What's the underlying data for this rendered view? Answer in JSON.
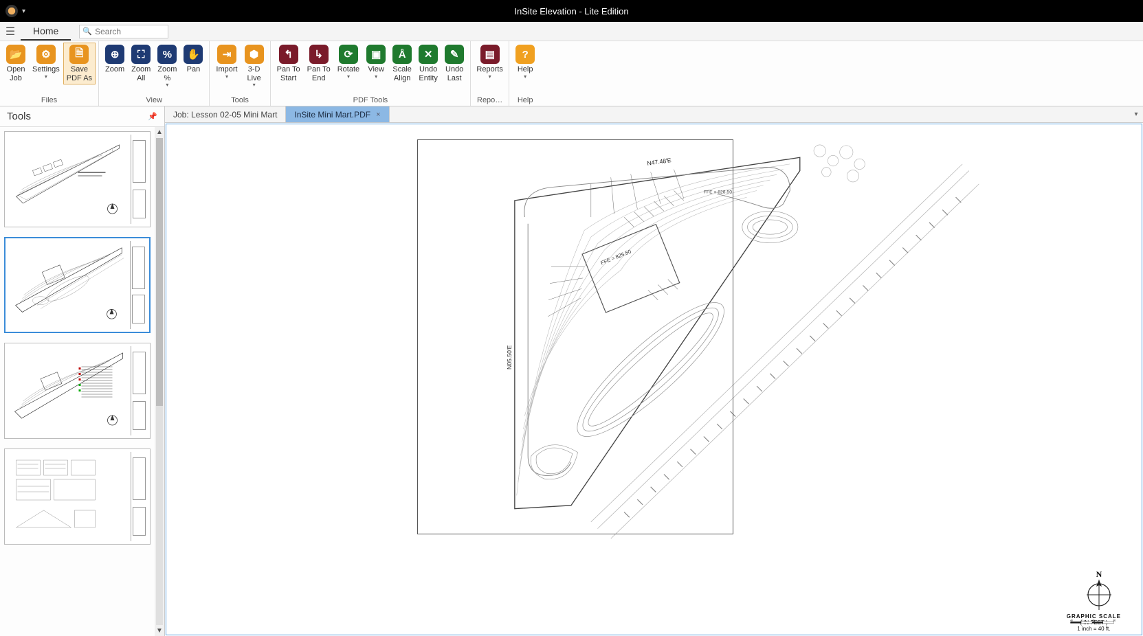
{
  "app": {
    "title": "InSite Elevation - Lite Edition"
  },
  "menu": {
    "home_tab": "Home",
    "search_placeholder": "Search"
  },
  "ribbon": {
    "groups": {
      "files": "Files",
      "view": "View",
      "tools": "Tools",
      "pdf_tools": "PDF Tools",
      "reports": "Repo…",
      "help": "Help"
    },
    "buttons": {
      "open_job": "Open\nJob",
      "settings": "Settings",
      "save_pdf_as": "Save\nPDF As",
      "zoom": "Zoom",
      "zoom_all": "Zoom\nAll",
      "zoom_pct": "Zoom\n%",
      "pan": "Pan",
      "import": "Import",
      "live_3d": "3-D\nLive",
      "pan_start": "Pan To\nStart",
      "pan_end": "Pan To\nEnd",
      "rotate": "Rotate",
      "view_btn": "View",
      "scale_align": "Scale\nAlign",
      "undo_entity": "Undo\nEntity",
      "undo_last": "Undo\nLast",
      "reports": "Reports",
      "help": "Help"
    }
  },
  "tools_panel": {
    "title": "Tools"
  },
  "tabs": [
    {
      "label": "Job: Lesson 02-05 Mini Mart",
      "active": false,
      "closeable": false
    },
    {
      "label": "InSite Mini Mart.PDF",
      "active": true,
      "closeable": true
    }
  ],
  "drawing": {
    "bearing_top": "N47.48'E",
    "bearing_left": "N05.50'E",
    "ffe": "FFE = 825.50",
    "graphic_scale_label": "GRAPHIC SCALE",
    "scale_units": "( IN FEET )",
    "scale_note": "1 inch = 40 ft.",
    "north_label": "N"
  }
}
